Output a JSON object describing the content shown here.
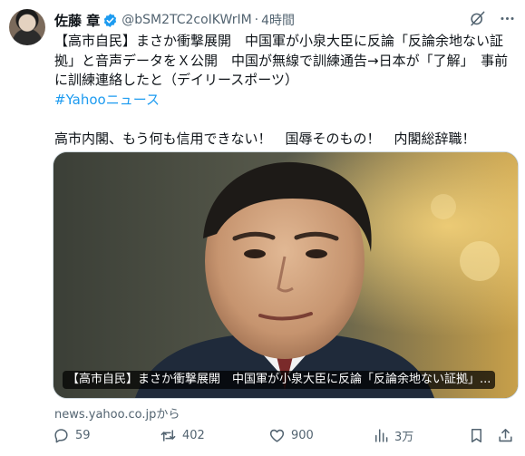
{
  "author": {
    "name": "佐藤 章",
    "handle": "@bSM2TC2coIKWrIM",
    "separator": "·",
    "time": "4時間"
  },
  "tweet": {
    "line1": "【高市自民】まさか衝撃展開　中国軍が小泉大臣に反論「反論余地ない証拠」と音声データをＸ公開　中国が無線で訓練通告→日本が「了解」　事前に訓練連絡したと（デイリースポーツ）",
    "hashtag": "#Yahooニュース",
    "line2": "高市内閣、もう何も信用できない！　国辱そのもの！　内閣総辞職！"
  },
  "card": {
    "caption": "【高市自民】まさか衝撃展開　中国軍が小泉大臣に反論「反論余地ない証拠」...",
    "source": "news.yahoo.co.jpから"
  },
  "actions": {
    "replies": "59",
    "reposts": "402",
    "likes": "900",
    "views": "3万"
  },
  "icons": [
    "grok-icon",
    "more-icon",
    "verified-icon",
    "reply-icon",
    "repost-icon",
    "like-icon",
    "views-icon",
    "bookmark-icon",
    "share-icon"
  ],
  "colors": {
    "accent": "#1d9bf0",
    "muted": "#536471",
    "text": "#0f1419"
  }
}
